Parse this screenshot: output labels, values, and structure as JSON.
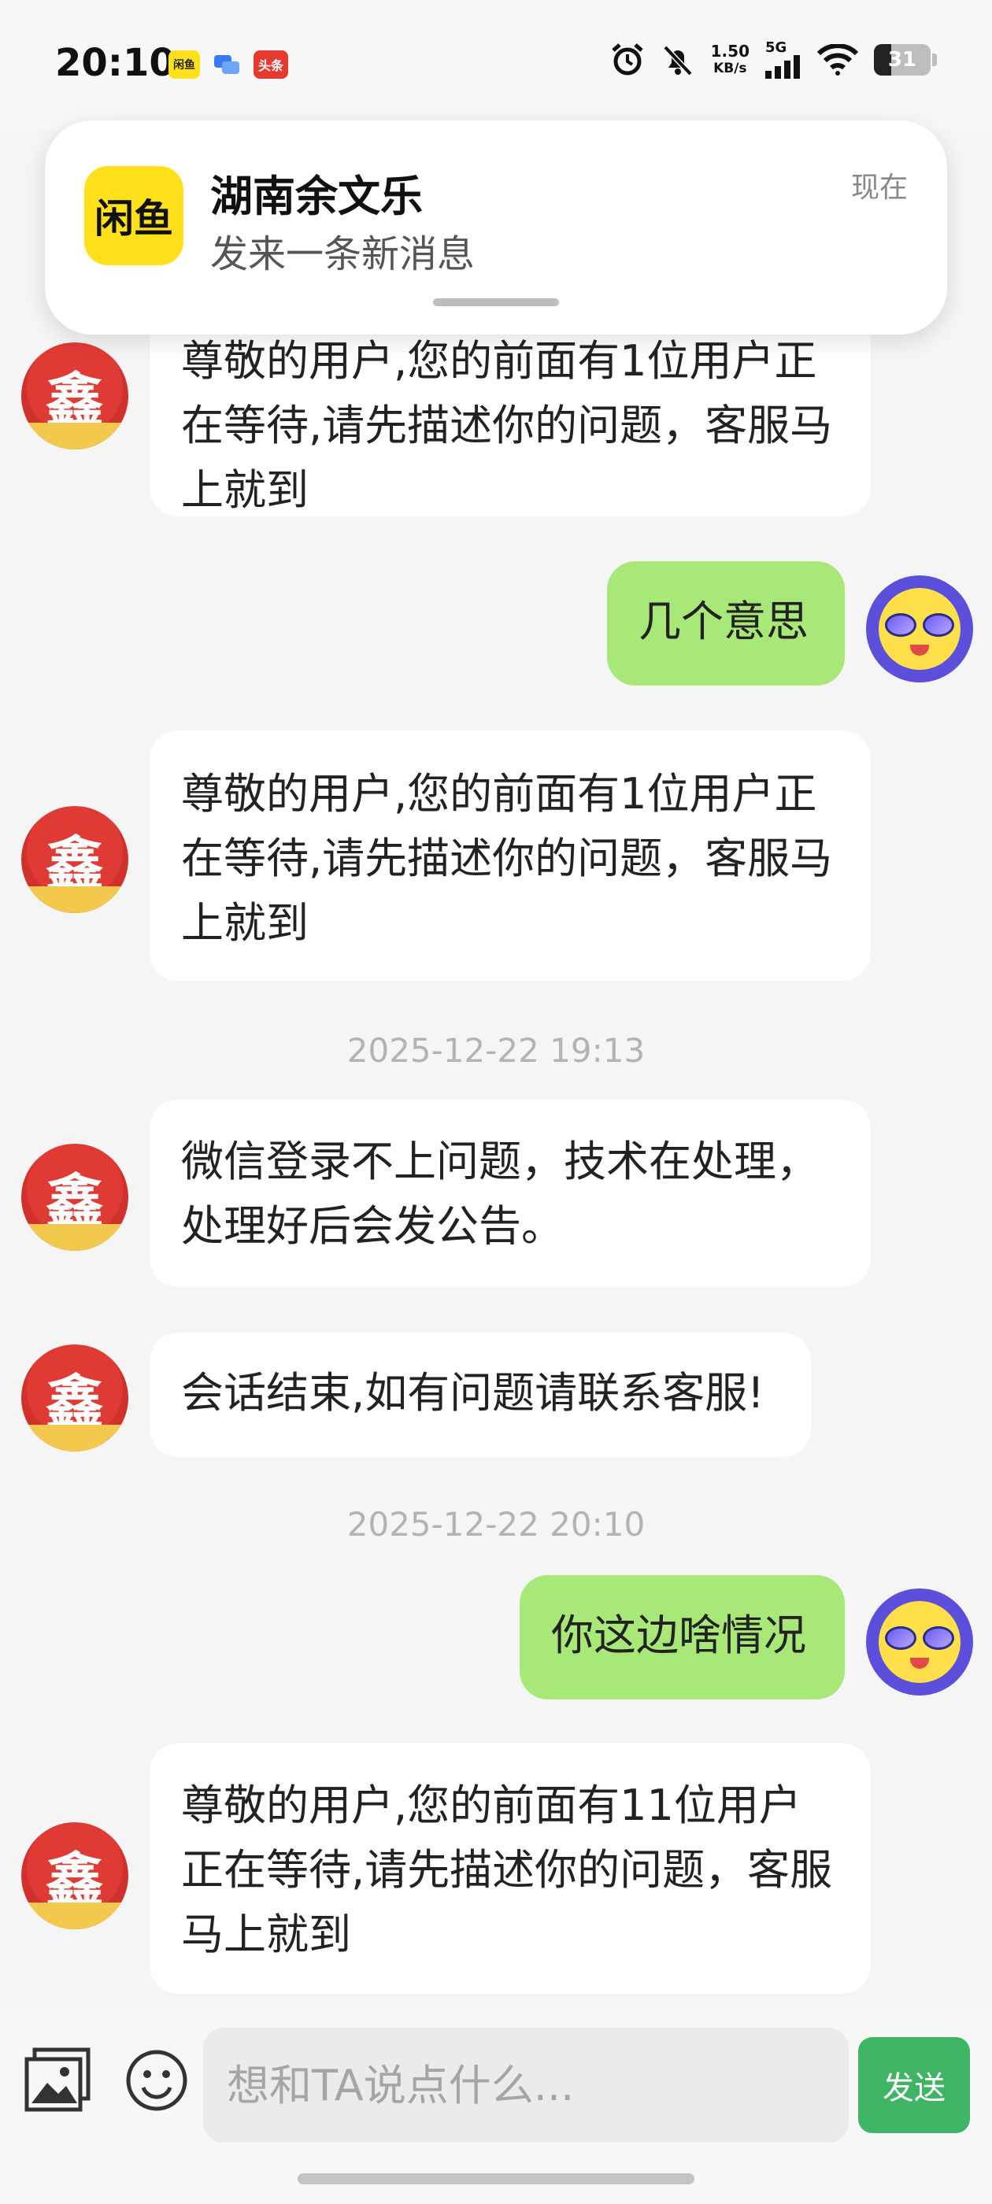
{
  "status_bar": {
    "time": "20:10",
    "app_icons": [
      "闲鱼",
      "消息",
      "头条"
    ],
    "network_speed_value": "1.50",
    "network_speed_unit": "KB/s",
    "network_type": "5G",
    "battery_level": "31"
  },
  "notification": {
    "app_icon_text": "闲鱼",
    "title": "湖南余文乐",
    "body": "发来一条新消息",
    "time": "现在"
  },
  "chat": {
    "messages": [
      {
        "sender": "service",
        "text": "尊敬的用户,您的前面有1位用户正在等待,请先描述你的问题，客服马上就到"
      },
      {
        "sender": "user",
        "text": "几个意思"
      },
      {
        "sender": "service",
        "text": "尊敬的用户,您的前面有1位用户正在等待,请先描述你的问题，客服马上就到"
      },
      {
        "sender": "service",
        "text": "微信登录不上问题，技术在处理，处理好后会发公告。"
      },
      {
        "sender": "service",
        "text": "会话结束,如有问题请联系客服!"
      },
      {
        "sender": "user",
        "text": "你这边啥情况"
      },
      {
        "sender": "service",
        "text": "尊敬的用户,您的前面有11位用户正在等待,请先描述你的问题，客服马上就到"
      }
    ],
    "timestamps": [
      "2025-12-22 19:13",
      "2025-12-22 20:10"
    ],
    "service_avatar_char": "鑫"
  },
  "input_bar": {
    "placeholder": "想和TA说点什么...",
    "send_label": "发送"
  }
}
